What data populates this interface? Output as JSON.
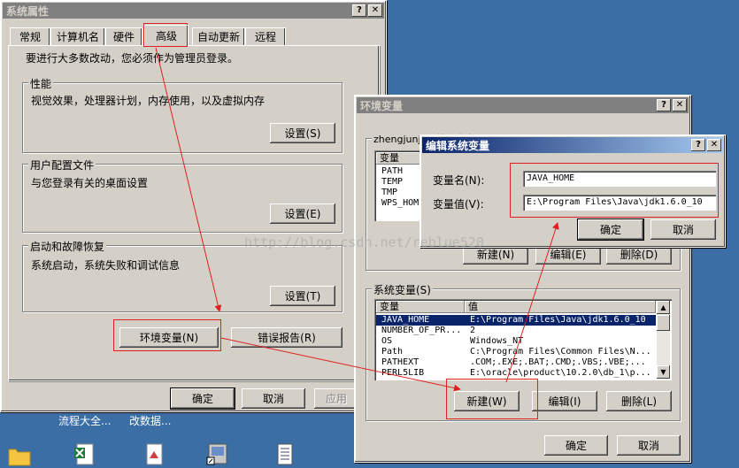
{
  "sysprops": {
    "title": "系统属性",
    "tabs": [
      "常规",
      "计算机名",
      "硬件",
      "高级",
      "自动更新",
      "远程"
    ],
    "notice": "要进行大多数改动，您必须作为管理员登录。",
    "performance": {
      "title": "性能",
      "desc": "视觉效果，处理器计划，内存使用，以及虚拟内存",
      "button": "设置(S)"
    },
    "profile": {
      "title": "用户配置文件",
      "desc": "与您登录有关的桌面设置",
      "button": "设置(E)"
    },
    "startup": {
      "title": "启动和故障恢复",
      "desc": "系统启动，系统失败和调试信息",
      "button": "设置(T)"
    },
    "env_button": "环境变量(N)",
    "error_button": "错误报告(R)",
    "ok": "确定",
    "cancel": "取消",
    "apply": "应用"
  },
  "envvars": {
    "title": "环境变量",
    "user_group": "zhengjunji... 的用户变量(U)",
    "user_list": {
      "col1": "变量",
      "rows": [
        "PATH",
        "TEMP",
        "TMP",
        "WPS_HOME"
      ]
    },
    "user_buttons": [
      "新建(N)",
      "编辑(E)",
      "删除(D)"
    ],
    "sys_group": "系统变量(S)",
    "sys_list": {
      "col1": "变量",
      "col2": "值",
      "rows": [
        {
          "name": "JAVA_HOME",
          "value": "E:\\Program Files\\Java\\jdk1.6.0_10"
        },
        {
          "name": "NUMBER_OF_PR...",
          "value": "2"
        },
        {
          "name": "OS",
          "value": "Windows_NT"
        },
        {
          "name": "Path",
          "value": "C:\\Program Files\\Common Files\\N..."
        },
        {
          "name": "PATHEXT",
          "value": ".COM;.EXE;.BAT;.CMD;.VBS;.VBE;..."
        },
        {
          "name": "PERL5LIB",
          "value": "E:\\oracle\\product\\10.2.0\\db_1\\p..."
        }
      ]
    },
    "sys_buttons": [
      "新建(W)",
      "编辑(I)",
      "删除(L)"
    ],
    "ok": "确定",
    "cancel": "取消"
  },
  "editdlg": {
    "title": "编辑系统变量",
    "name_label": "变量名(N):",
    "name_value": "JAVA_HOME",
    "value_label": "变量值(V):",
    "value_value": "E:\\Program Files\\Java\\jdk1.6.0_10",
    "ok": "确定",
    "cancel": "取消"
  },
  "watermark": "http://blog.csdn.net/reblue520",
  "desktop": {
    "labels": [
      "流程大全...",
      "改数据..."
    ]
  },
  "colors": {
    "annotation": "#e02020",
    "desktop": "#3a6ea5",
    "title_active": "#0a246a",
    "title_inactive": "#808080"
  }
}
